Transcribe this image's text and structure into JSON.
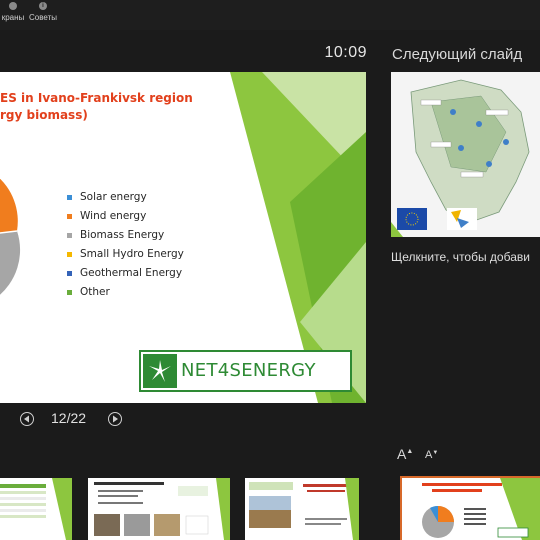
{
  "topbar": {
    "items": [
      {
        "label": "краны",
        "icon": "screen-icon"
      },
      {
        "label": "Советы",
        "icon": "info-icon"
      }
    ]
  },
  "timer": "10:09",
  "next_slide_label": "Следующий слайд",
  "current_slide": {
    "title": "ES in Ivano-Frankivsk region\nrgy biomass)",
    "legend": [
      {
        "label": "Solar energy",
        "color": "#3b8fd6"
      },
      {
        "label": "Wind energy",
        "color": "#f07d1e"
      },
      {
        "label": "Biomass Energy",
        "color": "#a6a6a6"
      },
      {
        "label": "Small Hydro Energy",
        "color": "#f5b800"
      },
      {
        "label": "Geothermal Energy",
        "color": "#3463b8"
      },
      {
        "label": "Other",
        "color": "#6aad3c"
      }
    ],
    "logo_text": "NET4SENERGY"
  },
  "navigation": {
    "counter": "12/22",
    "prev_icon": "triangle-left-icon",
    "next_icon": "triangle-right-icon"
  },
  "notes_placeholder": "Щелкните, чтобы добави",
  "font_controls": {
    "increase": "A",
    "decrease": "A"
  },
  "filmstrip": {
    "active_index": 4,
    "thumbs": [
      {
        "title": ""
      },
      {
        "title": "IVANO-FRANKIVSK AND CHERNIVTSI OE CONSULTING PROJECT"
      },
      {
        "title": ""
      },
      {
        "title": ""
      },
      {
        "title": "Energy Potential from RES in Ivano-Frankivsk region (with energy biomass)"
      }
    ]
  }
}
